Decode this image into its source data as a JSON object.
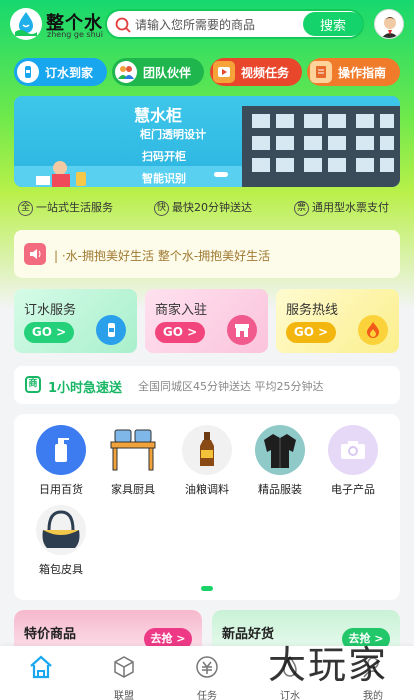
{
  "header": {
    "logo_title": "整个水",
    "logo_sub": "zheng ge shui",
    "search_placeholder": "请输入您所需要的商品",
    "search_button": "搜索"
  },
  "quick_links": [
    {
      "label": "订水到家",
      "icon": "water-bottle-icon",
      "color": "#18a6ee"
    },
    {
      "label": "团队伙伴",
      "icon": "team-icon",
      "color": "#1fb64e"
    },
    {
      "label": "视频任务",
      "icon": "video-icon",
      "color": "#e8472c"
    },
    {
      "label": "操作指南",
      "icon": "guide-icon",
      "color": "#f07b2a"
    }
  ],
  "banner": {
    "title": "慧水柜",
    "lines": [
      "柜门透明设计",
      "扫码开柜",
      "智能识别"
    ]
  },
  "features": [
    {
      "icon": "全",
      "label": "一站式生活服务"
    },
    {
      "icon": "快",
      "label": "最快20分钟送达"
    },
    {
      "icon": "票",
      "label": "通用型水票支付"
    }
  ],
  "notice": {
    "text": "| ·水-拥抱美好生活     整个水-拥抱美好生活"
  },
  "services": [
    {
      "title": "订水服务",
      "go": "GO >",
      "icon": "water-bottle-icon",
      "go_color": "#24d07a"
    },
    {
      "title": "商家入驻",
      "go": "GO >",
      "icon": "shop-icon",
      "go_color": "#f2457d"
    },
    {
      "title": "服务热线",
      "go": "GO >",
      "icon": "fire-icon",
      "go_color": "#f3b60e"
    }
  ],
  "delivery": {
    "icon": "商",
    "title": "1小时急速送",
    "desc": "全国同城区45分钟送达 平均25分钟达"
  },
  "categories": [
    {
      "label": "日用百货",
      "icon": "bottle-icon"
    },
    {
      "label": "家具厨具",
      "icon": "table-icon"
    },
    {
      "label": "油粮调料",
      "icon": "sauce-icon"
    },
    {
      "label": "精品服装",
      "icon": "jacket-icon"
    },
    {
      "label": "电子产品",
      "icon": "camera-icon"
    },
    {
      "label": "箱包皮具",
      "icon": "bag-icon"
    }
  ],
  "promos": [
    {
      "title": "特价商品",
      "button": "去抢 >"
    },
    {
      "title": "新品好货",
      "button": "去抢 >"
    }
  ],
  "tabbar": [
    {
      "label": "",
      "icon": "home-icon",
      "active": true
    },
    {
      "label": "联盟",
      "icon": "cube-icon"
    },
    {
      "label": "任务",
      "icon": "coin-icon"
    },
    {
      "label": "订水",
      "icon": "water-icon"
    },
    {
      "label": "我的",
      "icon": "user-icon"
    }
  ],
  "watermark": "大玩家",
  "colors": {
    "brand_green": "#14d36a",
    "accent_blue": "#19a8f0"
  }
}
